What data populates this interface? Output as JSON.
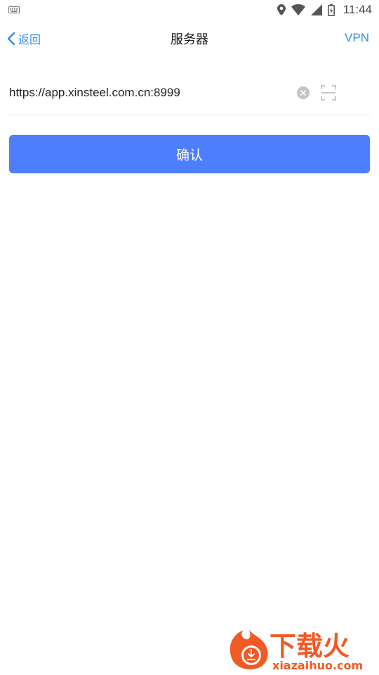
{
  "status_bar": {
    "time": "11:44",
    "icons": [
      "keyboard-icon",
      "location-icon",
      "wifi-icon",
      "cell-signal-icon",
      "battery-icon"
    ]
  },
  "nav": {
    "back_label": "返回",
    "title": "服务器",
    "vpn_label": "VPN"
  },
  "server": {
    "value": "https://app.xinsteel.com.cn:8999"
  },
  "confirm_label": "确认",
  "watermark": {
    "brand": "下载火",
    "domain": "xiazaihuo.com"
  },
  "colors": {
    "accent": "#2f8ee0",
    "button": "#4d7ffc",
    "watermark_orange": "#f05a24"
  }
}
